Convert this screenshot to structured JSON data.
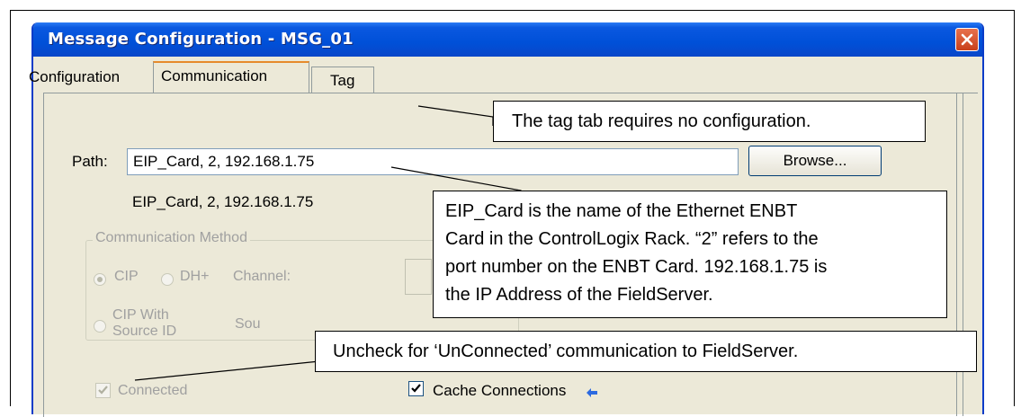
{
  "window": {
    "title": "Message Configuration - MSG_01"
  },
  "tabs": [
    {
      "label": "Configuration"
    },
    {
      "label": "Communication"
    },
    {
      "label": "Tag"
    }
  ],
  "path": {
    "label": "Path:",
    "value": "EIP_Card, 2, 192.168.1.75",
    "resolved": "EIP_Card, 2, 192.168.1.75",
    "browse_label": "Browse..."
  },
  "comm_method": {
    "group_label": "Communication Method",
    "cip_label": "CIP",
    "dhplus_label": "DH+",
    "channel_label": "Channel:",
    "cip_source_label_1": "CIP With",
    "cip_source_label_2": "Source ID",
    "source_link_label": "Sou",
    "selected": "CIP"
  },
  "checks": {
    "connected_label": "Connected",
    "connected_checked": true,
    "cache_label": "Cache Connections",
    "cache_checked": true
  },
  "callouts": {
    "tag": "The tag tab requires no configuration.",
    "path_1": "EIP_Card is the name of the Ethernet ENBT",
    "path_2": "Card in the ControlLogix Rack. “2” refers to the",
    "path_3": "port number on the ENBT Card. 192.168.1.75 is",
    "path_4": "the IP Address of the FieldServer.",
    "connected": "Uncheck for ‘UnConnected’ communication to FieldServer."
  },
  "colors": {
    "titlebar": "#0050d8",
    "dialog_bg": "#ece9d8",
    "close": "#d9512c"
  }
}
